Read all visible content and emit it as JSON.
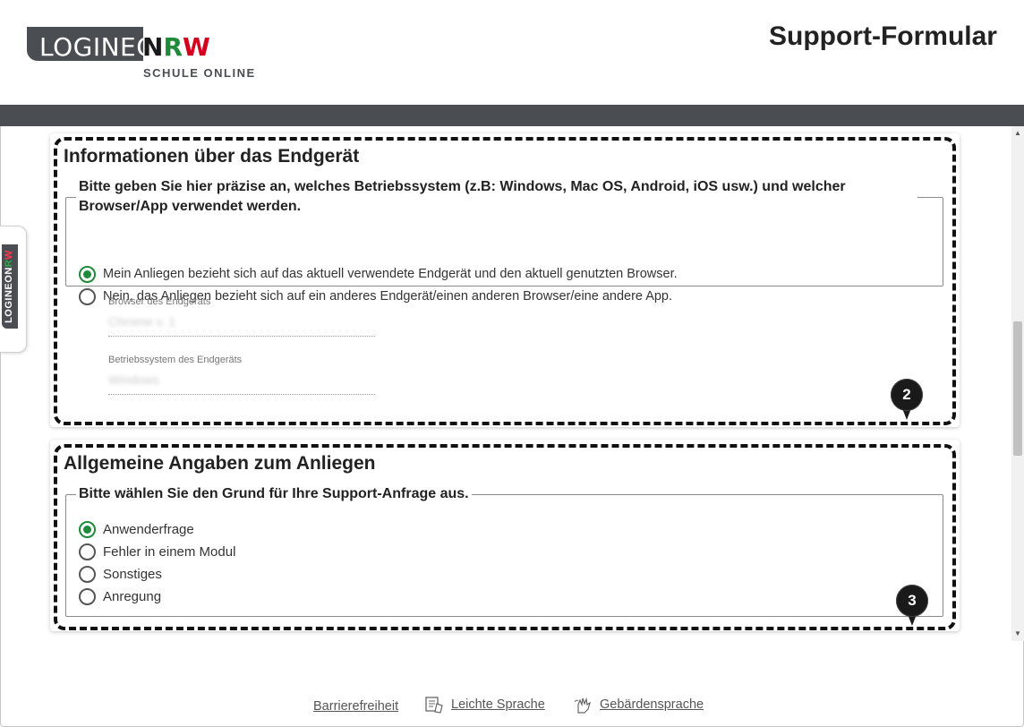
{
  "header": {
    "logo_main": "LOGINEO",
    "logo_n": "N",
    "logo_r": "R",
    "logo_w": "W",
    "logo_sub": "SCHULE ONLINE",
    "title": "Support-Formular"
  },
  "side_tab": {
    "text_main": "LOGINEO",
    "text_n": "N",
    "text_r": "R",
    "text_w": "W"
  },
  "section_device": {
    "title": "Informationen über das Endgerät",
    "legend": "Bitte geben Sie hier präzise an, welches Betriebssystem (z.B: Windows, Mac OS, Android, iOS usw.) und welcher Browser/App verwendet werden.",
    "options": [
      {
        "label": "Mein Anliegen bezieht sich auf das aktuell verwendete Endgerät und den aktuell genutzten Browser.",
        "checked": true
      },
      {
        "label": "Nein, das Anliegen bezieht sich auf ein anderes Endgerät/einen anderen Browser/eine andere App.",
        "checked": false
      }
    ],
    "browser_label": "Browser des Endgeräts",
    "browser_value": "Chrome v. 1",
    "os_label": "Betriebssystem des Endgeräts",
    "os_value": "Windows",
    "marker": "2"
  },
  "section_general": {
    "title": "Allgemeine Angaben zum Anliegen",
    "legend": "Bitte wählen Sie den Grund für Ihre Support-Anfrage aus.",
    "options": [
      {
        "label": "Anwenderfrage",
        "checked": true
      },
      {
        "label": "Fehler in einem Modul",
        "checked": false
      },
      {
        "label": "Sonstiges",
        "checked": false
      },
      {
        "label": "Anregung",
        "checked": false
      }
    ],
    "marker": "3"
  },
  "footer": {
    "accessibility": "Barrierefreiheit",
    "easy_language": "Leichte Sprache",
    "sign_language": "Gebärdensprache"
  },
  "colors": {
    "accent_green": "#1e8a3a",
    "nrw_red": "#d2001e",
    "bar_gray": "#4a4d52"
  }
}
